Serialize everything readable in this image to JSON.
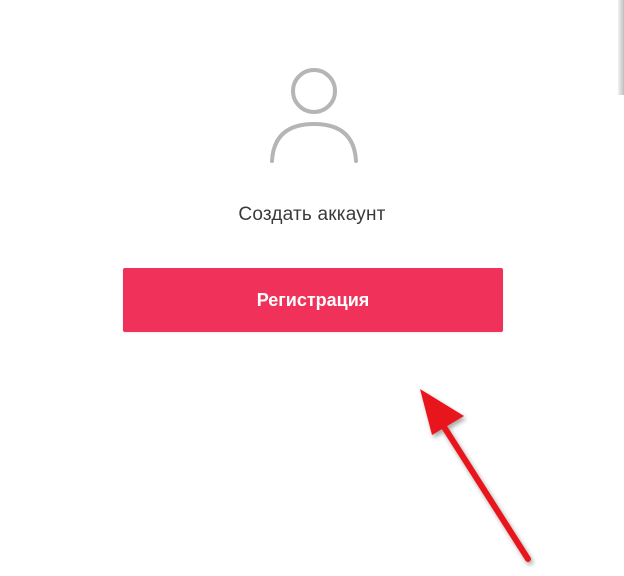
{
  "signup": {
    "title": "Создать аккаунт",
    "button_label": "Регистрация"
  },
  "icons": {
    "avatar": "user-avatar-icon",
    "annotation": "red-arrow-icon"
  },
  "colors": {
    "button": "#f0315a",
    "button_text": "#ffffff",
    "avatar_stroke": "#b5b5b5",
    "label_text": "#3a3a3a",
    "arrow": "#e8141a",
    "background": "#ffffff"
  }
}
